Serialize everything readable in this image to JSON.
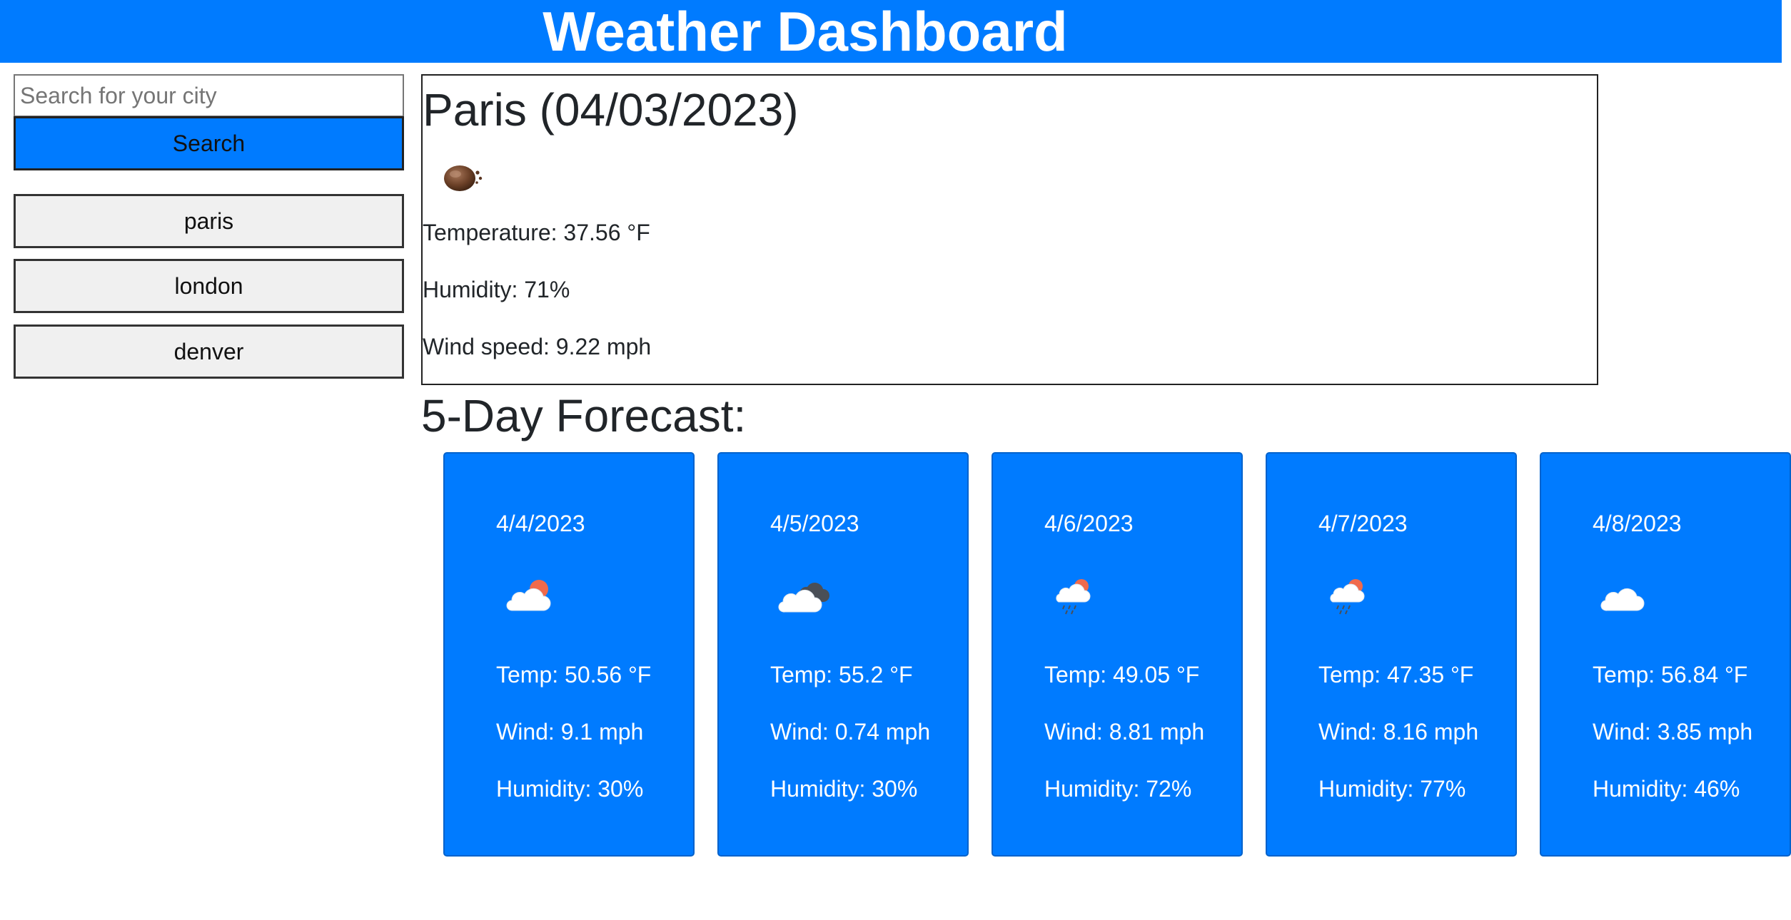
{
  "header": {
    "title": "Weather Dashboard"
  },
  "search": {
    "placeholder": "Search for your city",
    "value": "",
    "button_label": "Search"
  },
  "history": [
    "paris",
    "london",
    "denver"
  ],
  "current": {
    "title": "Paris (04/03/2023)",
    "icon": "broken-clouds-night-icon",
    "temperature": "Temperature: 37.56 °F",
    "humidity": "Humidity: 71%",
    "wind": "Wind speed: 9.22 mph"
  },
  "forecast": {
    "heading": "5-Day Forecast:",
    "days": [
      {
        "date": "4/4/2023",
        "icon": "partly-cloudy-icon",
        "temp": "Temp: 50.56 °F",
        "wind": "Wind: 9.1 mph",
        "humidity": "Humidity: 30%"
      },
      {
        "date": "4/5/2023",
        "icon": "broken-clouds-icon",
        "temp": "Temp: 55.2 °F",
        "wind": "Wind: 0.74 mph",
        "humidity": "Humidity: 30%"
      },
      {
        "date": "4/6/2023",
        "icon": "light-rain-icon",
        "temp": "Temp: 49.05 °F",
        "wind": "Wind: 8.81 mph",
        "humidity": "Humidity: 72%"
      },
      {
        "date": "4/7/2023",
        "icon": "light-rain-icon",
        "temp": "Temp: 47.35 °F",
        "wind": "Wind: 8.16 mph",
        "humidity": "Humidity: 77%"
      },
      {
        "date": "4/8/2023",
        "icon": "cloud-icon",
        "temp": "Temp: 56.84 °F",
        "wind": "Wind: 3.85 mph",
        "humidity": "Humidity: 46%"
      }
    ]
  },
  "colors": {
    "accent": "#007bff",
    "card_text": "#ffffff",
    "history_button_bg": "#f0f0f0",
    "sun": "#f06a4c"
  }
}
